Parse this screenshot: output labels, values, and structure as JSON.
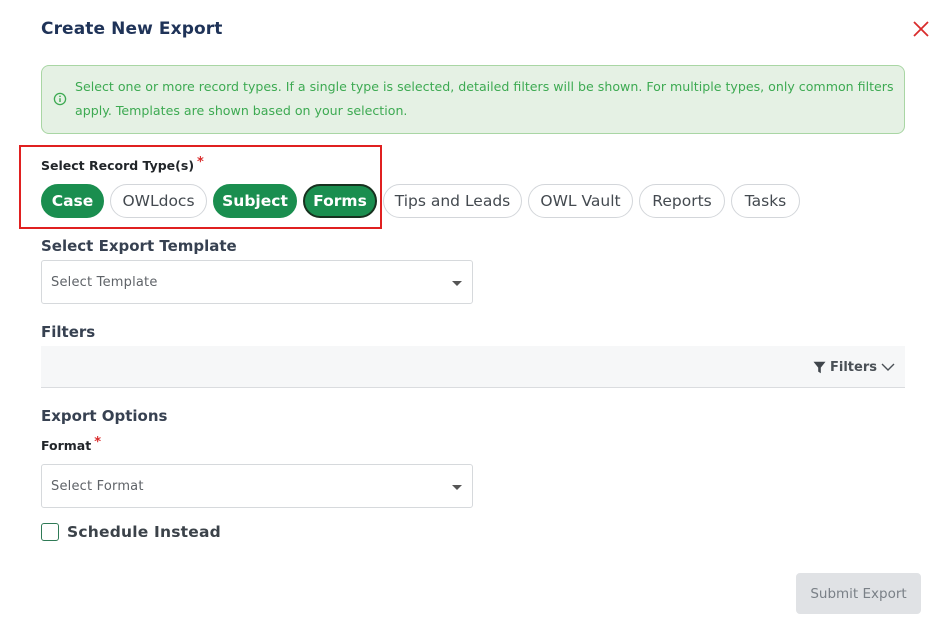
{
  "modal": {
    "title": "Create New Export",
    "close_icon": "close-icon",
    "accent_color": "#1a8e4f",
    "close_color": "#d92b2b"
  },
  "info": {
    "icon": "info-circle-icon",
    "text": "Select one or more record types. If a single type is selected, detailed filters will be shown. For multiple types, only common filters apply. Templates are shown based on your selection."
  },
  "record_types": {
    "label": "Select Record Type(s)",
    "required_marker": "*",
    "items": [
      {
        "label": "Case",
        "selected": true
      },
      {
        "label": "OWLdocs",
        "selected": false
      },
      {
        "label": "Subject",
        "selected": true
      },
      {
        "label": "Forms",
        "selected": true
      },
      {
        "label": "Tips and Leads",
        "selected": false
      },
      {
        "label": "OWL Vault",
        "selected": false
      },
      {
        "label": "Reports",
        "selected": false
      },
      {
        "label": "Tasks",
        "selected": false
      }
    ]
  },
  "template": {
    "title": "Select Export Template",
    "placeholder": "Select Template"
  },
  "filters": {
    "title": "Filters",
    "toggle_label": "Filters",
    "icons": [
      "filter-icon",
      "chevron-down-icon"
    ]
  },
  "export_options": {
    "title": "Export Options",
    "format_label": "Format",
    "required_marker": "*",
    "format_placeholder": "Select Format",
    "schedule_label": "Schedule Instead",
    "schedule_checked": false
  },
  "submit": {
    "label": "Submit Export",
    "disabled": true
  }
}
